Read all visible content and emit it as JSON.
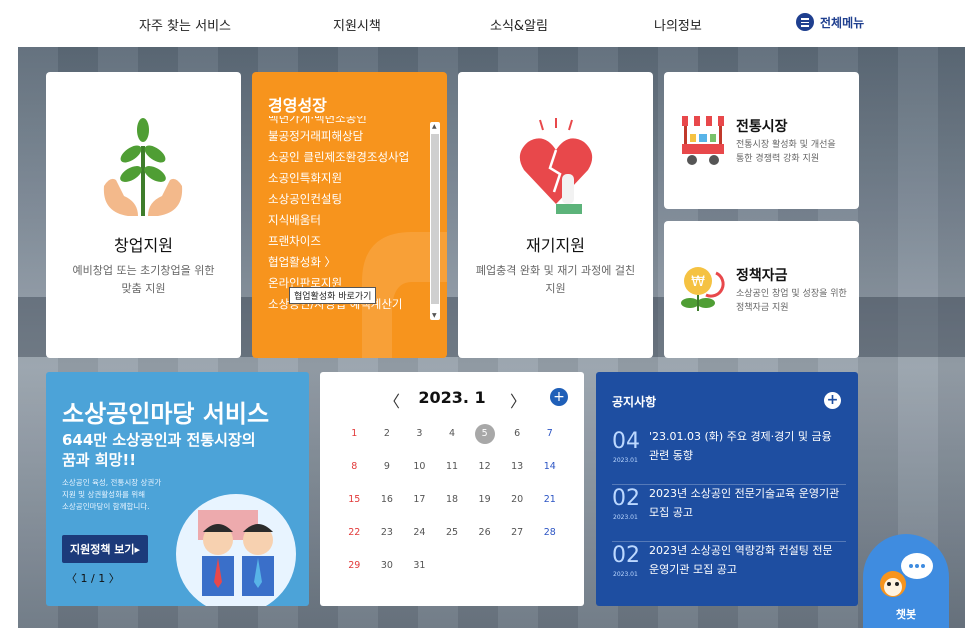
{
  "nav": {
    "items": [
      "자주 찾는 서비스",
      "지원시책",
      "소식&알림",
      "나의정보"
    ],
    "all_menu": "전체메뉴"
  },
  "cards": {
    "startup": {
      "title": "창업지원",
      "desc_line1": "예비창업 또는 초기창업을 위한",
      "desc_line2": "맞춤 지원"
    },
    "growth": {
      "title": "경영성장",
      "items": [
        "백년가게·백년소공인",
        "불공정거래피해상담",
        "소공인 클린제조환경조성사업",
        "소공인특화지원",
        "소상공인컨설팅",
        "지식배움터",
        "프랜차이즈",
        "협업활성화 〉",
        "온라인판로지원",
        "소상공인/자영업 혜택계산기"
      ],
      "tooltip": "협업활성화 바로가기"
    },
    "restart": {
      "title": "재기지원",
      "desc_line1": "폐업충격 완화 및 재기 과정에 걸친",
      "desc_line2": "지원"
    },
    "market": {
      "title": "전통시장",
      "desc_line1": "전통시장 활성화 및 개선을",
      "desc_line2": "통한 경쟁력 강화 지원"
    },
    "fund": {
      "title": "정책자금",
      "desc_line1": "소상공인 창업 및 성장을 위한",
      "desc_line2": "정책자금 지원"
    }
  },
  "banner": {
    "headline": "소상공인마당 서비스",
    "sub_line1": "644만 소상공인과 전통시장의",
    "sub_line2": "꿈과 희망!!",
    "small_line1": "소상공인 육성, 전통시장 상권가",
    "small_line2": "지원 및 상권활성화를 위해",
    "small_line3": "소상공인마당이 함께합니다.",
    "button": "지원정책 보기▸",
    "pager": "〈 1 / 1 〉"
  },
  "calendar": {
    "month": "2023. 1",
    "prev": "〈",
    "next": "〉",
    "add": "+",
    "weeks": [
      [
        "1",
        "2",
        "3",
        "4",
        "5",
        "6",
        "7"
      ],
      [
        "8",
        "9",
        "10",
        "11",
        "12",
        "13",
        "14"
      ],
      [
        "15",
        "16",
        "17",
        "18",
        "19",
        "20",
        "21"
      ],
      [
        "22",
        "23",
        "24",
        "25",
        "26",
        "27",
        "28"
      ],
      [
        "29",
        "30",
        "31",
        "",
        "",
        "",
        ""
      ]
    ],
    "today": "5"
  },
  "notices": {
    "title": "공지사항",
    "plus": "+",
    "items": [
      {
        "day": "04",
        "ym": "2023.01",
        "text": "'23.01.03 (화) 주요 경제·경기 및 금융 관련 동향"
      },
      {
        "day": "02",
        "ym": "2023.01",
        "text": "2023년 소상공인 전문기술교육 운영기관 모집 공고"
      },
      {
        "day": "02",
        "ym": "2023.01",
        "text": "2023년 소상공인 역량강화 컨설팅 전문 운영기관 모집 공고"
      }
    ]
  },
  "chatbot": {
    "label": "챗봇"
  },
  "colors": {
    "accent_orange": "#f7941d",
    "notice_blue": "#1e4ea1",
    "banner_blue": "#4ca3d8",
    "nav_blue": "#1f3f8f"
  }
}
